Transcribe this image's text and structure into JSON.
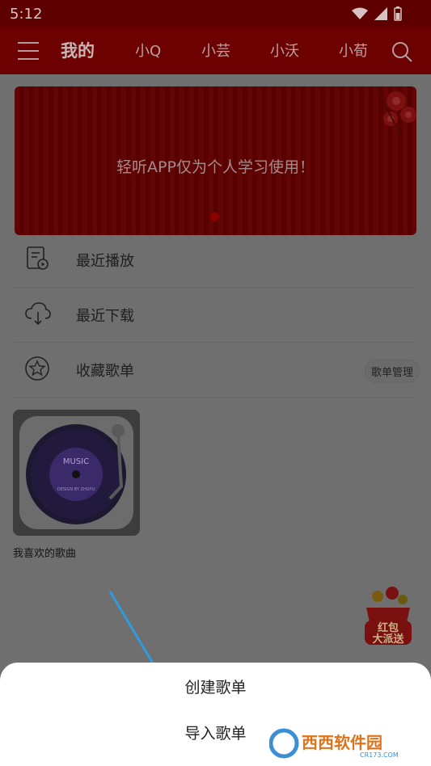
{
  "status_bar": {
    "time": "5:12"
  },
  "header": {
    "active_tab": "我的",
    "tabs": [
      "小Q",
      "小芸",
      "小沃",
      "小荀"
    ]
  },
  "banner": {
    "text": "轻听APP仅为个人学习使用！"
  },
  "menu": [
    {
      "label": "最近播放",
      "icon": "recent-play-icon"
    },
    {
      "label": "最近下载",
      "icon": "download-cloud-icon"
    },
    {
      "label": "收藏歌单",
      "icon": "star-icon"
    }
  ],
  "manage_label": "歌单管理",
  "playlist": {
    "caption": "我喜欢的歌曲",
    "cover_text": "MUSIC",
    "cover_subtext": "DESIGN BY ZHUYU"
  },
  "redpacket": {
    "line1": "红包",
    "line2": "大派送"
  },
  "sheet": {
    "create": "创建歌单",
    "import": "导入歌单"
  },
  "watermark": {
    "text": "西西软件园",
    "sub": "CR173.COM"
  },
  "colors": {
    "header": "#6d0000",
    "status_bar": "#5e0000",
    "overlay_bg": "#707070",
    "sheet_bg": "#ffffff",
    "arrow": "#2f9be0"
  }
}
